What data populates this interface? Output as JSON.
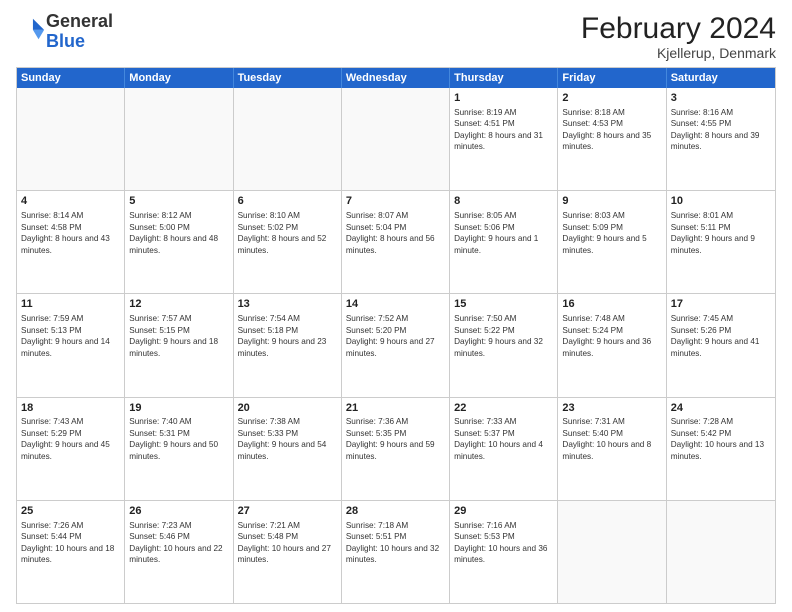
{
  "header": {
    "logo_general": "General",
    "logo_blue": "Blue",
    "month_year": "February 2024",
    "location": "Kjellerup, Denmark"
  },
  "days_of_week": [
    "Sunday",
    "Monday",
    "Tuesday",
    "Wednesday",
    "Thursday",
    "Friday",
    "Saturday"
  ],
  "weeks": [
    [
      {
        "day": "",
        "sunrise": "",
        "sunset": "",
        "daylight": ""
      },
      {
        "day": "",
        "sunrise": "",
        "sunset": "",
        "daylight": ""
      },
      {
        "day": "",
        "sunrise": "",
        "sunset": "",
        "daylight": ""
      },
      {
        "day": "",
        "sunrise": "",
        "sunset": "",
        "daylight": ""
      },
      {
        "day": "1",
        "sunrise": "Sunrise: 8:19 AM",
        "sunset": "Sunset: 4:51 PM",
        "daylight": "Daylight: 8 hours and 31 minutes."
      },
      {
        "day": "2",
        "sunrise": "Sunrise: 8:18 AM",
        "sunset": "Sunset: 4:53 PM",
        "daylight": "Daylight: 8 hours and 35 minutes."
      },
      {
        "day": "3",
        "sunrise": "Sunrise: 8:16 AM",
        "sunset": "Sunset: 4:55 PM",
        "daylight": "Daylight: 8 hours and 39 minutes."
      }
    ],
    [
      {
        "day": "4",
        "sunrise": "Sunrise: 8:14 AM",
        "sunset": "Sunset: 4:58 PM",
        "daylight": "Daylight: 8 hours and 43 minutes."
      },
      {
        "day": "5",
        "sunrise": "Sunrise: 8:12 AM",
        "sunset": "Sunset: 5:00 PM",
        "daylight": "Daylight: 8 hours and 48 minutes."
      },
      {
        "day": "6",
        "sunrise": "Sunrise: 8:10 AM",
        "sunset": "Sunset: 5:02 PM",
        "daylight": "Daylight: 8 hours and 52 minutes."
      },
      {
        "day": "7",
        "sunrise": "Sunrise: 8:07 AM",
        "sunset": "Sunset: 5:04 PM",
        "daylight": "Daylight: 8 hours and 56 minutes."
      },
      {
        "day": "8",
        "sunrise": "Sunrise: 8:05 AM",
        "sunset": "Sunset: 5:06 PM",
        "daylight": "Daylight: 9 hours and 1 minute."
      },
      {
        "day": "9",
        "sunrise": "Sunrise: 8:03 AM",
        "sunset": "Sunset: 5:09 PM",
        "daylight": "Daylight: 9 hours and 5 minutes."
      },
      {
        "day": "10",
        "sunrise": "Sunrise: 8:01 AM",
        "sunset": "Sunset: 5:11 PM",
        "daylight": "Daylight: 9 hours and 9 minutes."
      }
    ],
    [
      {
        "day": "11",
        "sunrise": "Sunrise: 7:59 AM",
        "sunset": "Sunset: 5:13 PM",
        "daylight": "Daylight: 9 hours and 14 minutes."
      },
      {
        "day": "12",
        "sunrise": "Sunrise: 7:57 AM",
        "sunset": "Sunset: 5:15 PM",
        "daylight": "Daylight: 9 hours and 18 minutes."
      },
      {
        "day": "13",
        "sunrise": "Sunrise: 7:54 AM",
        "sunset": "Sunset: 5:18 PM",
        "daylight": "Daylight: 9 hours and 23 minutes."
      },
      {
        "day": "14",
        "sunrise": "Sunrise: 7:52 AM",
        "sunset": "Sunset: 5:20 PM",
        "daylight": "Daylight: 9 hours and 27 minutes."
      },
      {
        "day": "15",
        "sunrise": "Sunrise: 7:50 AM",
        "sunset": "Sunset: 5:22 PM",
        "daylight": "Daylight: 9 hours and 32 minutes."
      },
      {
        "day": "16",
        "sunrise": "Sunrise: 7:48 AM",
        "sunset": "Sunset: 5:24 PM",
        "daylight": "Daylight: 9 hours and 36 minutes."
      },
      {
        "day": "17",
        "sunrise": "Sunrise: 7:45 AM",
        "sunset": "Sunset: 5:26 PM",
        "daylight": "Daylight: 9 hours and 41 minutes."
      }
    ],
    [
      {
        "day": "18",
        "sunrise": "Sunrise: 7:43 AM",
        "sunset": "Sunset: 5:29 PM",
        "daylight": "Daylight: 9 hours and 45 minutes."
      },
      {
        "day": "19",
        "sunrise": "Sunrise: 7:40 AM",
        "sunset": "Sunset: 5:31 PM",
        "daylight": "Daylight: 9 hours and 50 minutes."
      },
      {
        "day": "20",
        "sunrise": "Sunrise: 7:38 AM",
        "sunset": "Sunset: 5:33 PM",
        "daylight": "Daylight: 9 hours and 54 minutes."
      },
      {
        "day": "21",
        "sunrise": "Sunrise: 7:36 AM",
        "sunset": "Sunset: 5:35 PM",
        "daylight": "Daylight: 9 hours and 59 minutes."
      },
      {
        "day": "22",
        "sunrise": "Sunrise: 7:33 AM",
        "sunset": "Sunset: 5:37 PM",
        "daylight": "Daylight: 10 hours and 4 minutes."
      },
      {
        "day": "23",
        "sunrise": "Sunrise: 7:31 AM",
        "sunset": "Sunset: 5:40 PM",
        "daylight": "Daylight: 10 hours and 8 minutes."
      },
      {
        "day": "24",
        "sunrise": "Sunrise: 7:28 AM",
        "sunset": "Sunset: 5:42 PM",
        "daylight": "Daylight: 10 hours and 13 minutes."
      }
    ],
    [
      {
        "day": "25",
        "sunrise": "Sunrise: 7:26 AM",
        "sunset": "Sunset: 5:44 PM",
        "daylight": "Daylight: 10 hours and 18 minutes."
      },
      {
        "day": "26",
        "sunrise": "Sunrise: 7:23 AM",
        "sunset": "Sunset: 5:46 PM",
        "daylight": "Daylight: 10 hours and 22 minutes."
      },
      {
        "day": "27",
        "sunrise": "Sunrise: 7:21 AM",
        "sunset": "Sunset: 5:48 PM",
        "daylight": "Daylight: 10 hours and 27 minutes."
      },
      {
        "day": "28",
        "sunrise": "Sunrise: 7:18 AM",
        "sunset": "Sunset: 5:51 PM",
        "daylight": "Daylight: 10 hours and 32 minutes."
      },
      {
        "day": "29",
        "sunrise": "Sunrise: 7:16 AM",
        "sunset": "Sunset: 5:53 PM",
        "daylight": "Daylight: 10 hours and 36 minutes."
      },
      {
        "day": "",
        "sunrise": "",
        "sunset": "",
        "daylight": ""
      },
      {
        "day": "",
        "sunrise": "",
        "sunset": "",
        "daylight": ""
      }
    ]
  ]
}
